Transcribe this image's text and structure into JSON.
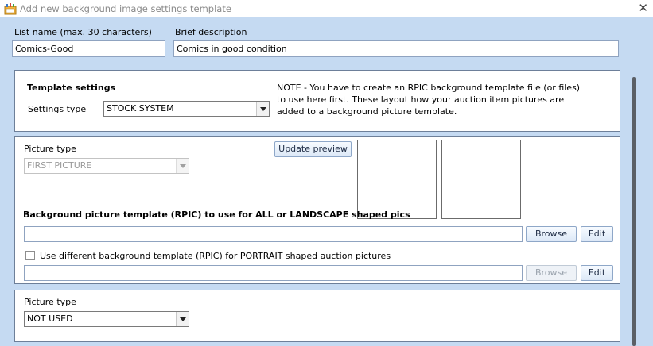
{
  "window": {
    "title": "Add new background image settings template",
    "close_glyph": "✕",
    "icon": "app-icon"
  },
  "header": {
    "list_name_label": "List name (max. 30 characters)",
    "list_name_value": "Comics-Good",
    "brief_desc_label": "Brief description",
    "brief_desc_value": "Comics in good condition"
  },
  "template_settings": {
    "heading": "Template settings",
    "settings_type_label": "Settings type",
    "settings_type_value": "STOCK SYSTEM",
    "note": "NOTE - You have to create an RPIC background template file (or files) to use here first.  These layout how your auction item pictures are added to a background picture template."
  },
  "picture1": {
    "picture_type_label": "Picture type",
    "picture_type_value": "FIRST PICTURE",
    "update_preview_label": "Update preview",
    "bg_template_label": "Background picture template (RPIC) to use for ALL or LANDSCAPE shaped pics",
    "bg_template_value": "",
    "browse_label": "Browse",
    "edit_label": "Edit",
    "portrait_checkbox_label": "Use different background template (RPIC) for PORTRAIT shaped auction pictures",
    "portrait_checked": false,
    "portrait_value": "",
    "browse2_label": "Browse",
    "edit2_label": "Edit"
  },
  "picture2": {
    "picture_type_label": "Picture type",
    "picture_type_value": "NOT USED"
  },
  "colors": {
    "background": "#c5daf2",
    "panel_border": "#6d7f99",
    "button_border": "#8ea7c8"
  }
}
